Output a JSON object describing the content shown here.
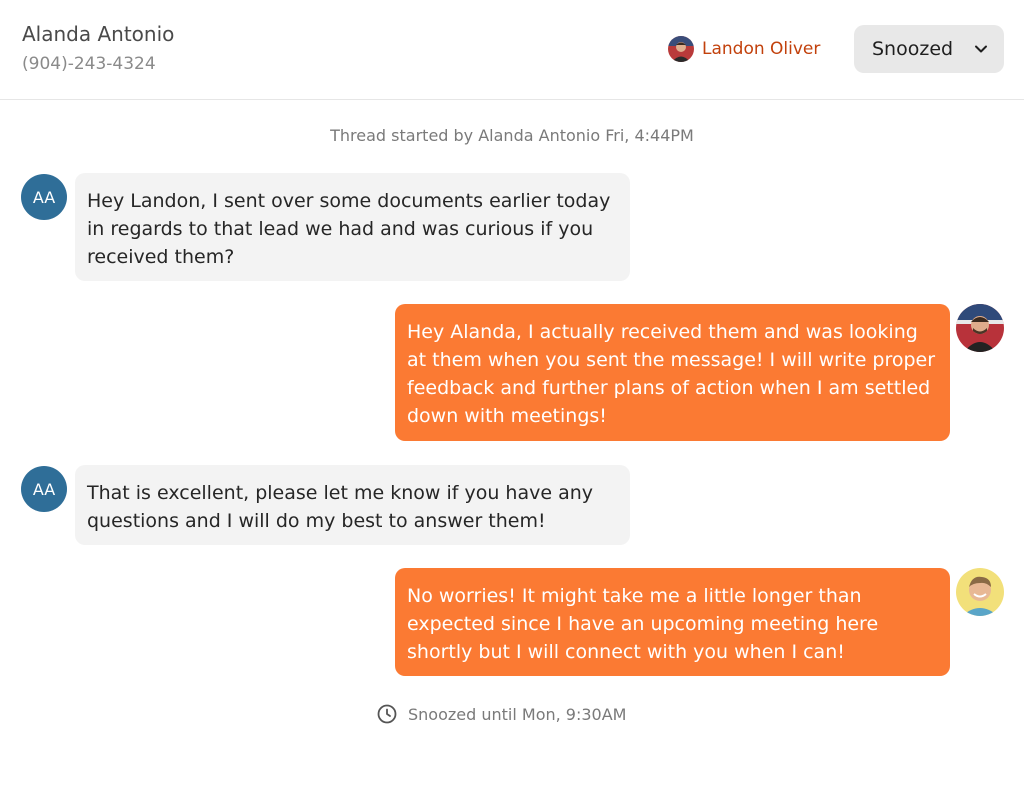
{
  "header": {
    "contact_name": "Alanda Antonio",
    "contact_phone": "(904)-243-4324",
    "assignee_name": "Landon Oliver",
    "status_label": "Snoozed"
  },
  "thread": {
    "started_text": "Thread started by Alanda Antonio Fri, 4:44PM",
    "snooze_text": "Snoozed until Mon, 9:30AM"
  },
  "messages": [
    {
      "direction": "in",
      "avatar_initials": "AA",
      "text": "Hey Landon, I sent over some documents earlier today in regards to that lead we had and was curious if you received them?"
    },
    {
      "direction": "out",
      "avatar": "user-photo-landon",
      "text": "Hey Alanda, I actually received them and was looking at them when you sent the message! I will write proper feedback and further plans of action when I am settled down with meetings!"
    },
    {
      "direction": "in",
      "avatar_initials": "AA",
      "text": "That is excellent, please let me know if you have any questions and I will do my best to answer them!"
    },
    {
      "direction": "out",
      "avatar": "user-photo-smiling-man",
      "text": "No worries! It might take me a little longer than expected since I have an upcoming meeting here shortly but I will connect with you when I can!"
    }
  ],
  "colors": {
    "outgoing_bubble": "#fb7a33",
    "incoming_bubble": "#f3f3f3",
    "initials_avatar": "#2f6e98",
    "assignee_text": "#c2410c",
    "status_button": "#e8e8e8"
  },
  "icons": {
    "dropdown": "chevron-down-icon",
    "snooze": "clock-icon"
  }
}
